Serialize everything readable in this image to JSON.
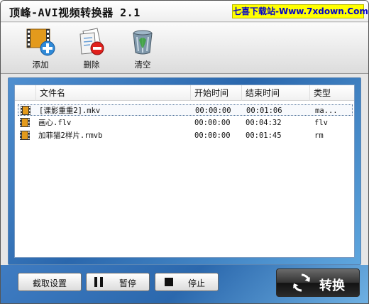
{
  "window": {
    "title": "顶峰-AVI视频转换器 2.1",
    "watermark": "七喜下载站-Www.7xdown.Com"
  },
  "toolbar": {
    "add_label": "添加",
    "delete_label": "删除",
    "clear_label": "清空"
  },
  "file_list": {
    "columns": {
      "name": "文件名",
      "start": "开始时间",
      "end": "结束时间",
      "type": "类型"
    },
    "rows": [
      {
        "name": "[课影重重2].mkv",
        "start": "00:00:00",
        "end": "00:01:06",
        "type": "ma...",
        "selected": true
      },
      {
        "name": "画心.flv",
        "start": "00:00:00",
        "end": "00:04:32",
        "type": "flv",
        "selected": false
      },
      {
        "name": "加菲猫2样片.rmvb",
        "start": "00:00:00",
        "end": "00:01:45",
        "type": "rm",
        "selected": false
      }
    ]
  },
  "bottom": {
    "capture_settings_label": "截取设置",
    "pause_label": "暂停",
    "stop_label": "停止",
    "convert_label": "转换"
  },
  "colors": {
    "panel_blue": "#2a67ad",
    "watermark_bg": "#ffff00",
    "watermark_text": "#0000cc"
  },
  "icons": {
    "add": "film-add-icon",
    "delete": "document-delete-icon",
    "clear": "trash-can-icon",
    "file": "film-icon",
    "pause": "pause-icon",
    "stop": "stop-icon",
    "convert": "refresh-icon"
  }
}
